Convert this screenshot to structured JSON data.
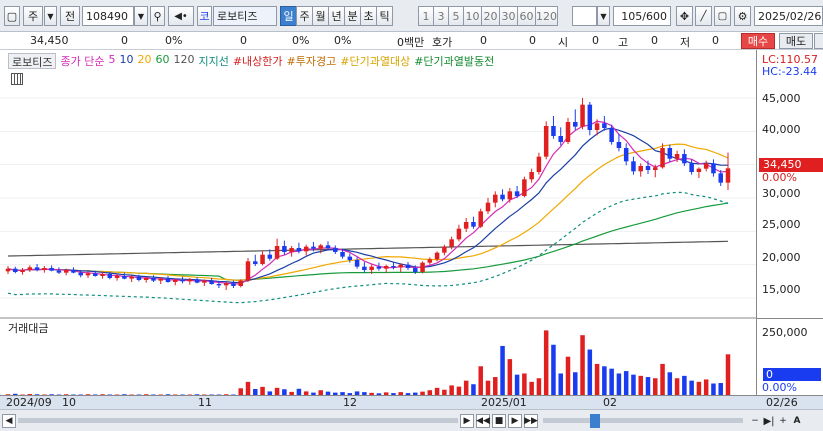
{
  "toolbar": {
    "market": "주",
    "kind": "전",
    "code": "108490",
    "exchange_badge": "코",
    "stock_name": "로보티즈",
    "periods": [
      "일",
      "주",
      "월",
      "년",
      "분",
      "초",
      "틱"
    ],
    "active_period": "일",
    "intervals": [
      "1",
      "3",
      "5",
      "10",
      "20",
      "30",
      "60",
      "120"
    ],
    "count": "105/600",
    "date": "2025/02/26"
  },
  "quote": {
    "price": "34,450",
    "change": "0",
    "change_pct": "0%",
    "volume": "0",
    "vol_pct": "0%",
    "amt_pct": "0%",
    "unit": "0백만",
    "hoga_label": "호가",
    "hoga_val": "0",
    "si_label": "시",
    "si_val": "0",
    "go_label": "고",
    "go_val": "0",
    "jeo_label": "저",
    "jeo_val": "0",
    "buy": "매수",
    "sell": "매도"
  },
  "legend": {
    "name": "로보티즈",
    "ma_title": "종가 단순",
    "ma5": "5",
    "ma10": "10",
    "ma20": "20",
    "ma60": "60",
    "ma120": "120",
    "support": "지지선",
    "upper_limit": "#내상한가",
    "invest_warn": "#투자경고",
    "overheat": "#단기과열대상",
    "overheat_trigger": "#단기과열발동전"
  },
  "right_axis": {
    "lc": "LC:110.57",
    "hc": "HC:-23.44",
    "ticks": [
      "45,000",
      "40,000",
      "35,000",
      "30,000",
      "25,000",
      "20,000",
      "15,000"
    ],
    "current_price": "34,450",
    "current_pct": "0.00%"
  },
  "volume_panel": {
    "title": "거래대금",
    "tick": "250,000",
    "current": "0",
    "current_pct": "0.00%"
  },
  "x_axis": {
    "labels": [
      "2024/09",
      "10",
      "11",
      "12",
      "2025/01",
      "02"
    ],
    "right_label": "02/26"
  },
  "colors": {
    "up": "#e02020",
    "down": "#1a3cf0",
    "ma5": "#d62ab5",
    "ma10": "#1b3ea6",
    "ma20": "#f0a800",
    "ma60": "#179b3d",
    "ma120": "#555555",
    "support": "#0f8f7e"
  },
  "chart_data": {
    "type": "candlestick",
    "y_range": [
      12000,
      48000
    ],
    "ohlc": [
      [
        19000,
        19800,
        18600,
        19400
      ],
      [
        19400,
        19700,
        18700,
        18900
      ],
      [
        18900,
        19500,
        18500,
        19200
      ],
      [
        19200,
        19900,
        18900,
        19600
      ],
      [
        19600,
        20100,
        19000,
        19200
      ],
      [
        19200,
        19800,
        18800,
        19500
      ],
      [
        19500,
        19900,
        19000,
        19100
      ],
      [
        19100,
        19600,
        18600,
        18800
      ],
      [
        18800,
        19400,
        18400,
        19200
      ],
      [
        19200,
        19600,
        18700,
        18800
      ],
      [
        18800,
        19200,
        18100,
        18400
      ],
      [
        18400,
        19000,
        18000,
        18700
      ],
      [
        18700,
        19100,
        18200,
        18300
      ],
      [
        18300,
        18900,
        17900,
        18600
      ],
      [
        18600,
        18900,
        17800,
        18000
      ],
      [
        18000,
        18600,
        17600,
        18300
      ],
      [
        18300,
        18800,
        17800,
        17900
      ],
      [
        17900,
        18400,
        17400,
        18200
      ],
      [
        18200,
        18500,
        17500,
        17700
      ],
      [
        17700,
        18200,
        17300,
        18000
      ],
      [
        18000,
        18400,
        17400,
        17600
      ],
      [
        17600,
        18100,
        17100,
        17900
      ],
      [
        17900,
        18300,
        17300,
        17400
      ],
      [
        17400,
        17900,
        16900,
        17700
      ],
      [
        17700,
        18200,
        17200,
        17500
      ],
      [
        17500,
        18000,
        17000,
        17800
      ],
      [
        17800,
        18100,
        17200,
        17300
      ],
      [
        17300,
        17800,
        16800,
        17600
      ],
      [
        17600,
        18000,
        17000,
        17100
      ],
      [
        17100,
        17500,
        16500,
        16900
      ],
      [
        16900,
        17400,
        16200,
        17200
      ],
      [
        17200,
        17600,
        16500,
        16800
      ],
      [
        16800,
        17800,
        16600,
        17600
      ],
      [
        17600,
        21000,
        17400,
        20500
      ],
      [
        20500,
        21500,
        19800,
        20100
      ],
      [
        20100,
        22000,
        19900,
        21500
      ],
      [
        21500,
        22300,
        20600,
        20900
      ],
      [
        20900,
        23900,
        20700,
        22800
      ],
      [
        22800,
        23600,
        21500,
        21900
      ],
      [
        21900,
        22800,
        21200,
        22500
      ],
      [
        22500,
        23300,
        21700,
        22000
      ],
      [
        22000,
        23000,
        21400,
        22700
      ],
      [
        22700,
        23400,
        22000,
        22400
      ],
      [
        22400,
        23100,
        21700,
        22900
      ],
      [
        22900,
        23500,
        22200,
        22500
      ],
      [
        22500,
        22900,
        21600,
        21900
      ],
      [
        21900,
        22400,
        20900,
        21200
      ],
      [
        21200,
        21700,
        20300,
        20700
      ],
      [
        20700,
        21100,
        19400,
        19700
      ],
      [
        19700,
        20400,
        18800,
        19200
      ],
      [
        19200,
        20000,
        18600,
        19700
      ],
      [
        19700,
        20300,
        19100,
        19400
      ],
      [
        19400,
        20000,
        18800,
        19800
      ],
      [
        19800,
        20400,
        19300,
        19600
      ],
      [
        19600,
        20200,
        18900,
        20000
      ],
      [
        20000,
        20400,
        19200,
        19500
      ],
      [
        19500,
        19900,
        18600,
        18900
      ],
      [
        18900,
        20500,
        18700,
        20300
      ],
      [
        20300,
        21100,
        20000,
        20800
      ],
      [
        20800,
        22000,
        20500,
        21800
      ],
      [
        21800,
        23000,
        21400,
        22700
      ],
      [
        22700,
        24200,
        22300,
        23800
      ],
      [
        23800,
        26000,
        23500,
        25400
      ],
      [
        25400,
        27000,
        24900,
        26400
      ],
      [
        26400,
        27200,
        25400,
        25700
      ],
      [
        25700,
        28400,
        25500,
        28000
      ],
      [
        28000,
        30000,
        27600,
        29300
      ],
      [
        29300,
        31000,
        28600,
        30500
      ],
      [
        30500,
        31300,
        29500,
        29800
      ],
      [
        29800,
        31500,
        29300,
        31000
      ],
      [
        31000,
        31800,
        30000,
        30300
      ],
      [
        30300,
        33200,
        30100,
        32800
      ],
      [
        32800,
        34400,
        32300,
        33900
      ],
      [
        33900,
        36800,
        33500,
        36200
      ],
      [
        36200,
        41500,
        35800,
        40800
      ],
      [
        40800,
        42300,
        38900,
        39300
      ],
      [
        39300,
        40600,
        37900,
        38400
      ],
      [
        38400,
        42000,
        38100,
        41400
      ],
      [
        41400,
        43300,
        40200,
        40700
      ],
      [
        40700,
        45000,
        40300,
        44000
      ],
      [
        44000,
        44400,
        39400,
        40200
      ],
      [
        40200,
        41800,
        39400,
        41200
      ],
      [
        41200,
        42300,
        40100,
        40500
      ],
      [
        40500,
        41000,
        38000,
        38400
      ],
      [
        38400,
        39600,
        37000,
        37500
      ],
      [
        37500,
        38200,
        34900,
        35500
      ],
      [
        35500,
        36200,
        33500,
        34000
      ],
      [
        34000,
        35200,
        33200,
        34800
      ],
      [
        34800,
        35600,
        33600,
        34200
      ],
      [
        34200,
        35000,
        33100,
        34600
      ],
      [
        34600,
        38200,
        34400,
        37500
      ],
      [
        37500,
        38000,
        35400,
        35900
      ],
      [
        35900,
        37100,
        35400,
        36600
      ],
      [
        36600,
        37300,
        34800,
        35200
      ],
      [
        35200,
        35800,
        33500,
        33900
      ],
      [
        33900,
        34600,
        33000,
        34400
      ],
      [
        34400,
        35600,
        34000,
        35200
      ],
      [
        35200,
        35800,
        33200,
        33700
      ],
      [
        33700,
        34200,
        31800,
        32300
      ],
      [
        32300,
        36800,
        31200,
        34450
      ]
    ],
    "turnover": [
      3,
      5,
      2,
      4,
      3,
      2,
      3,
      2,
      3,
      2,
      2,
      3,
      2,
      3,
      2,
      2,
      3,
      2,
      2,
      3,
      2,
      2,
      3,
      2,
      2,
      2,
      3,
      2,
      2,
      2,
      3,
      2,
      28,
      55,
      25,
      34,
      15,
      30,
      24,
      13,
      26,
      15,
      10,
      20,
      14,
      10,
      12,
      8,
      15,
      12,
      9,
      7,
      11,
      8,
      12,
      8,
      10,
      14,
      20,
      30,
      22,
      40,
      35,
      60,
      45,
      120,
      60,
      75,
      205,
      150,
      85,
      90,
      55,
      70,
      270,
      210,
      90,
      160,
      95,
      250,
      190,
      130,
      120,
      110,
      90,
      100,
      85,
      80,
      75,
      70,
      130,
      95,
      70,
      80,
      60,
      55,
      65,
      48,
      50,
      170
    ]
  }
}
